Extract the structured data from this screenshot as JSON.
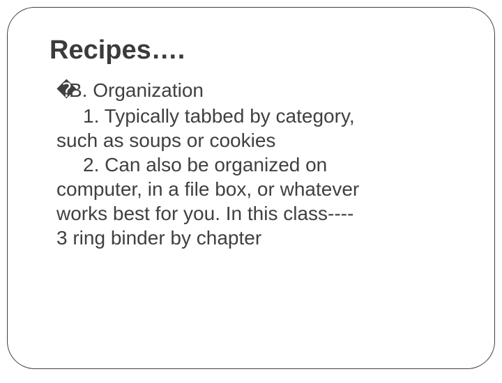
{
  "title": "Recipes….",
  "bullet_glyph": "�",
  "heading": "B. Organization",
  "item1_num": "1.",
  "item1_text_line1": "Typically tabbed by category,",
  "item1_text_line2": "such as soups or cookies",
  "item2_num": "2.",
  "item2_text_line1": "Can also be organized on",
  "item2_text_line2": "computer, in a file box, or whatever",
  "item2_text_line3": "works best for you. In this class----",
  "item2_text_line4": "3 ring binder by chapter"
}
